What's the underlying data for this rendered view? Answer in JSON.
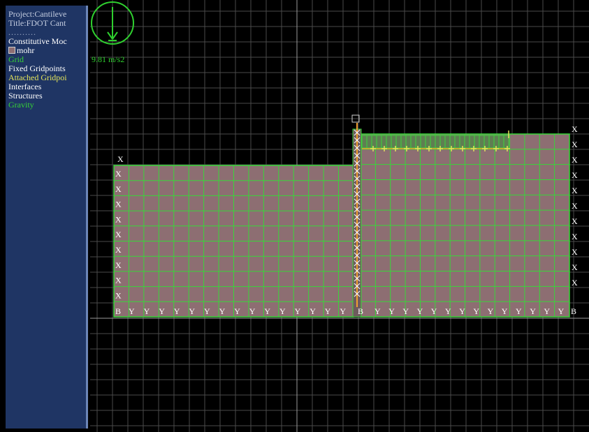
{
  "legend": {
    "project": "Project:Cantileve",
    "title": "Title:FDOT Cant",
    "separator": "..........",
    "constitutive_header": "Constitutive Moc",
    "mohr_label": "mohr",
    "grid_label": "Grid",
    "fixed_gridpoints_label": "Fixed Gridpoints",
    "attached_gridpoints_label": "Attached Gridpoi",
    "interfaces_label": "Interfaces",
    "structures_label": "Structures",
    "gravity_label": "Gravity"
  },
  "gravity_indicator": {
    "value": "9.81 m/s2"
  },
  "colors": {
    "background": "#000000",
    "panel": "#1f3564",
    "soil": "#8d6e72",
    "grid": "#39d639",
    "fixity_x": "#ffffff",
    "fixity_y": "#ffffff",
    "attached": "#e3e35a",
    "structure": "#f0a030",
    "gravity": "#2fd02f"
  },
  "fixity_symbols": {
    "x": "X",
    "y": "Y",
    "b": "B"
  }
}
